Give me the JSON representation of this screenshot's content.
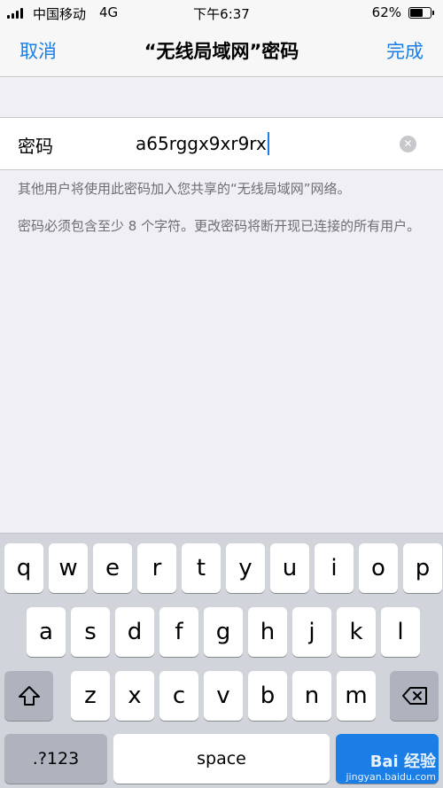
{
  "status_bar": {
    "carrier": "中国移动",
    "network": "4G",
    "time": "下午6:37",
    "battery_percent": "62%",
    "battery_level": 0.62
  },
  "nav": {
    "cancel_label": "取消",
    "title": "“无线局域网”密码",
    "done_label": "完成"
  },
  "password_field": {
    "label": "密码",
    "value": "a65rggx9xr9rx"
  },
  "notes": {
    "share_note": "其他用户将使用此密码加入您共享的“无线局域网”网络。",
    "requirement_note": "密码必须包含至少 8 个字符。更改密码将断开现已连接的所有用户。"
  },
  "keyboard": {
    "row1": [
      "q",
      "w",
      "e",
      "r",
      "t",
      "y",
      "u",
      "i",
      "o",
      "p"
    ],
    "row2": [
      "a",
      "s",
      "d",
      "f",
      "g",
      "h",
      "j",
      "k",
      "l"
    ],
    "row3": [
      "z",
      "x",
      "c",
      "v",
      "b",
      "n",
      "m"
    ],
    "numbers_label": ".?123",
    "space_label": "space",
    "shift_icon": "shift-icon",
    "delete_icon": "backspace-icon"
  },
  "watermark": {
    "brand": "Bai 经验",
    "url": "jingyan.baidu.com"
  }
}
